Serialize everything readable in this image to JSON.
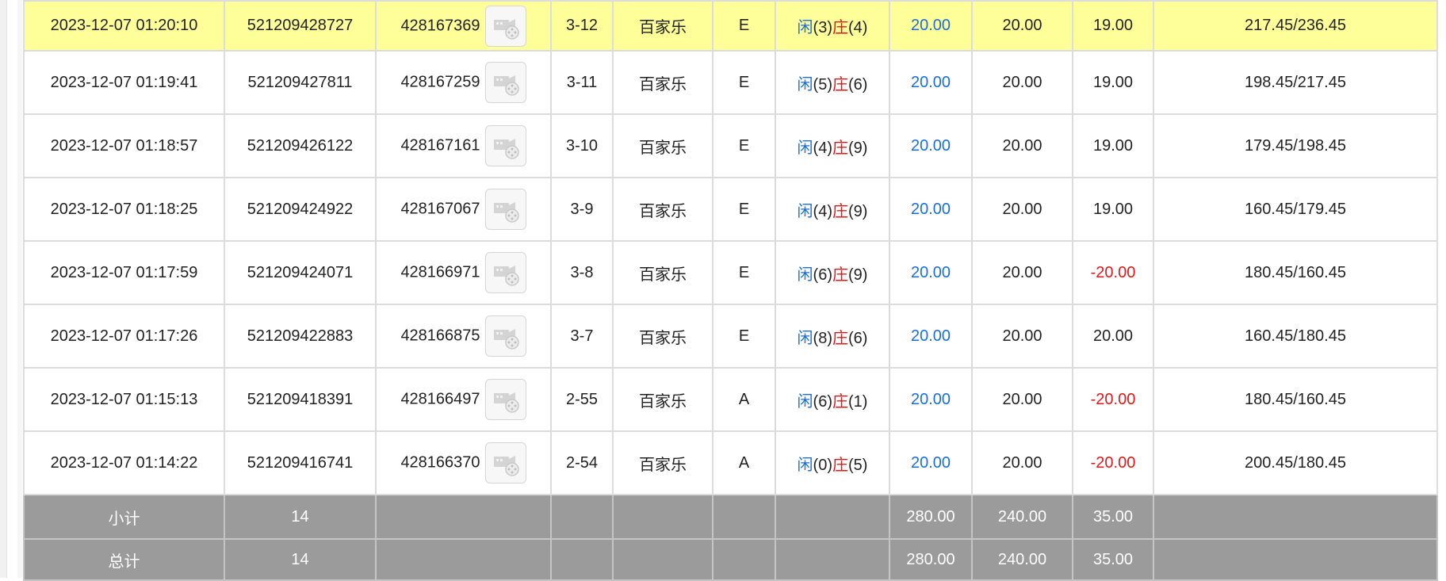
{
  "rows": [
    {
      "time": "2023-12-07 01:20:10",
      "bet_id": "521209428727",
      "round_id": "428167369",
      "shoe": "3-12",
      "game": "百家乐",
      "table": "E",
      "player_label": "闲",
      "player_points": "(3)",
      "banker_label": "庄",
      "banker_points": "(4)",
      "bet": "20.00",
      "valid": "20.00",
      "win": "19.00",
      "win_color": "normal",
      "balance": "217.45/236.45",
      "highlight": true
    },
    {
      "time": "2023-12-07 01:19:41",
      "bet_id": "521209427811",
      "round_id": "428167259",
      "shoe": "3-11",
      "game": "百家乐",
      "table": "E",
      "player_label": "闲",
      "player_points": "(5)",
      "banker_label": "庄",
      "banker_points": "(6)",
      "bet": "20.00",
      "valid": "20.00",
      "win": "19.00",
      "win_color": "normal",
      "balance": "198.45/217.45",
      "highlight": false
    },
    {
      "time": "2023-12-07 01:18:57",
      "bet_id": "521209426122",
      "round_id": "428167161",
      "shoe": "3-10",
      "game": "百家乐",
      "table": "E",
      "player_label": "闲",
      "player_points": "(4)",
      "banker_label": "庄",
      "banker_points": "(9)",
      "bet": "20.00",
      "valid": "20.00",
      "win": "19.00",
      "win_color": "normal",
      "balance": "179.45/198.45",
      "highlight": false
    },
    {
      "time": "2023-12-07 01:18:25",
      "bet_id": "521209424922",
      "round_id": "428167067",
      "shoe": "3-9",
      "game": "百家乐",
      "table": "E",
      "player_label": "闲",
      "player_points": "(4)",
      "banker_label": "庄",
      "banker_points": "(9)",
      "bet": "20.00",
      "valid": "20.00",
      "win": "19.00",
      "win_color": "normal",
      "balance": "160.45/179.45",
      "highlight": false
    },
    {
      "time": "2023-12-07 01:17:59",
      "bet_id": "521209424071",
      "round_id": "428166971",
      "shoe": "3-8",
      "game": "百家乐",
      "table": "E",
      "player_label": "闲",
      "player_points": "(6)",
      "banker_label": "庄",
      "banker_points": "(9)",
      "bet": "20.00",
      "valid": "20.00",
      "win": "-20.00",
      "win_color": "red",
      "balance": "180.45/160.45",
      "highlight": false
    },
    {
      "time": "2023-12-07 01:17:26",
      "bet_id": "521209422883",
      "round_id": "428166875",
      "shoe": "3-7",
      "game": "百家乐",
      "table": "E",
      "player_label": "闲",
      "player_points": "(8)",
      "banker_label": "庄",
      "banker_points": "(6)",
      "bet": "20.00",
      "valid": "20.00",
      "win": "20.00",
      "win_color": "normal",
      "balance": "160.45/180.45",
      "highlight": false
    },
    {
      "time": "2023-12-07 01:15:13",
      "bet_id": "521209418391",
      "round_id": "428166497",
      "shoe": "2-55",
      "game": "百家乐",
      "table": "A",
      "player_label": "闲",
      "player_points": "(6)",
      "banker_label": "庄",
      "banker_points": "(1)",
      "bet": "20.00",
      "valid": "20.00",
      "win": "-20.00",
      "win_color": "red",
      "balance": "180.45/160.45",
      "highlight": false
    },
    {
      "time": "2023-12-07 01:14:22",
      "bet_id": "521209416741",
      "round_id": "428166370",
      "shoe": "2-54",
      "game": "百家乐",
      "table": "A",
      "player_label": "闲",
      "player_points": "(0)",
      "banker_label": "庄",
      "banker_points": "(5)",
      "bet": "20.00",
      "valid": "20.00",
      "win": "-20.00",
      "win_color": "red",
      "balance": "200.45/180.45",
      "highlight": false
    }
  ],
  "subtotal": {
    "label": "小计",
    "count": "14",
    "bet": "280.00",
    "valid": "240.00",
    "win": "35.00"
  },
  "total": {
    "label": "总计",
    "count": "14",
    "bet": "280.00",
    "valid": "240.00",
    "win": "35.00"
  },
  "colors": {
    "highlight": "#ffff99",
    "player": "#1a6ee0",
    "banker": "#e01818",
    "loss": "#e01818",
    "summary_bg": "#9b9b9b"
  },
  "icons": {
    "replay": "video-replay-icon"
  }
}
